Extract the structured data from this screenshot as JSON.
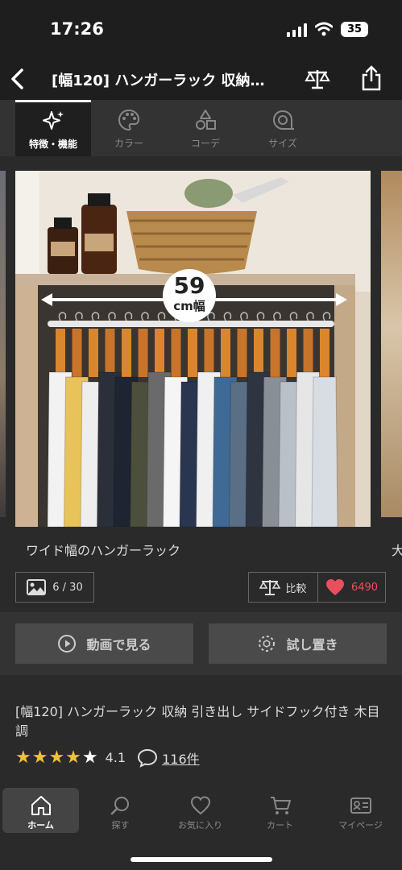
{
  "status_bar": {
    "time": "17:26",
    "battery": "35"
  },
  "header": {
    "title": "[幅120] ハンガーラック 収納…"
  },
  "tabs": [
    {
      "label": "特徴・機能",
      "icon": "sparkle-icon",
      "active": true
    },
    {
      "label": "カラー",
      "icon": "palette-icon",
      "active": false
    },
    {
      "label": "コーデ",
      "icon": "shapes-icon",
      "active": false
    },
    {
      "label": "サイズ",
      "icon": "tape-measure-icon",
      "active": false
    }
  ],
  "gallery": {
    "width_number": "59",
    "width_unit": "cm幅",
    "caption": "ワイド幅のハンガーラック",
    "next_caption_peek": "大",
    "image_counter": "6 / 30"
  },
  "actions": {
    "compare_label": "比較",
    "favorite_count": "6490",
    "favorite_color": "#e8505b",
    "video_button": "動画で見る",
    "try_button": "試し置き"
  },
  "product": {
    "name": "[幅120] ハンガーラック 収納 引き出し サイドフック付き 木目調",
    "rating": 4.1,
    "rating_text": "4.1",
    "stars_filled": 4,
    "stars_total": 5,
    "review_count": "116件",
    "star_color": "#f2c230"
  },
  "bottom_nav": [
    {
      "label": "ホーム",
      "icon": "home-icon",
      "active": true
    },
    {
      "label": "探す",
      "icon": "search-icon",
      "active": false
    },
    {
      "label": "お気に入り",
      "icon": "heart-icon",
      "active": false
    },
    {
      "label": "カート",
      "icon": "cart-icon",
      "active": false
    },
    {
      "label": "マイページ",
      "icon": "id-card-icon",
      "active": false
    }
  ]
}
